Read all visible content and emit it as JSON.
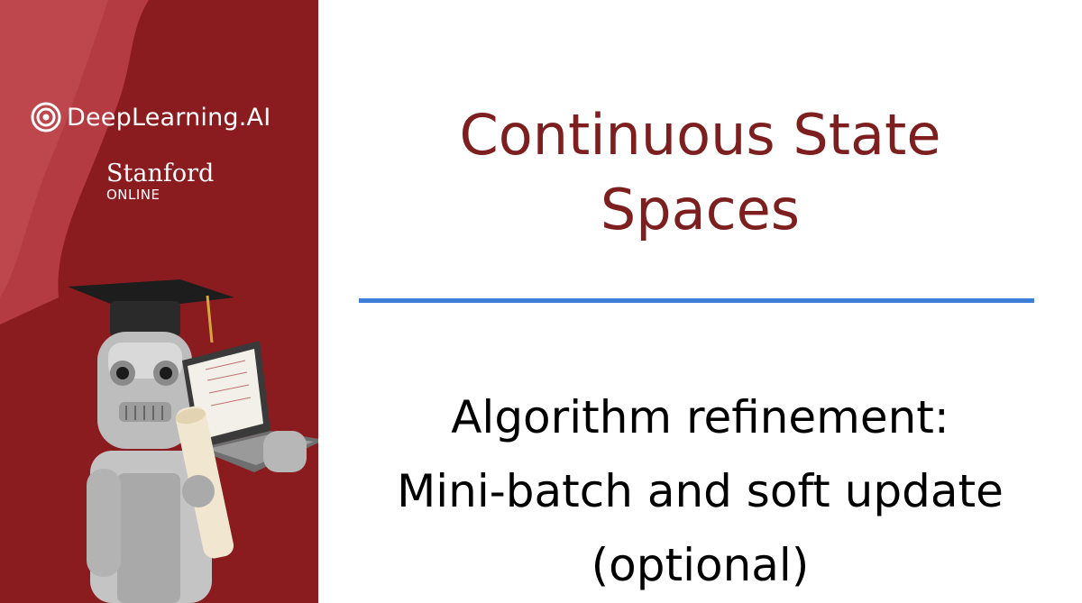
{
  "branding": {
    "deeplearning_logo_text": "DeepLearning.AI",
    "stanford_name": "Stanford",
    "stanford_online": "ONLINE"
  },
  "slide": {
    "title_line1": "Continuous State",
    "title_line2": "Spaces",
    "subtitle_line1": "Algorithm refinement:",
    "subtitle_line2": "Mini-batch and soft update",
    "subtitle_line3": "(optional)"
  },
  "colors": {
    "sidebar_bg": "#8a1c1f",
    "title": "#7e1f1f",
    "divider": "#3d7ed8",
    "subtitle": "#000000"
  },
  "icons": [
    "deeplearning-logo-icon",
    "robot-graduate-illustration"
  ]
}
